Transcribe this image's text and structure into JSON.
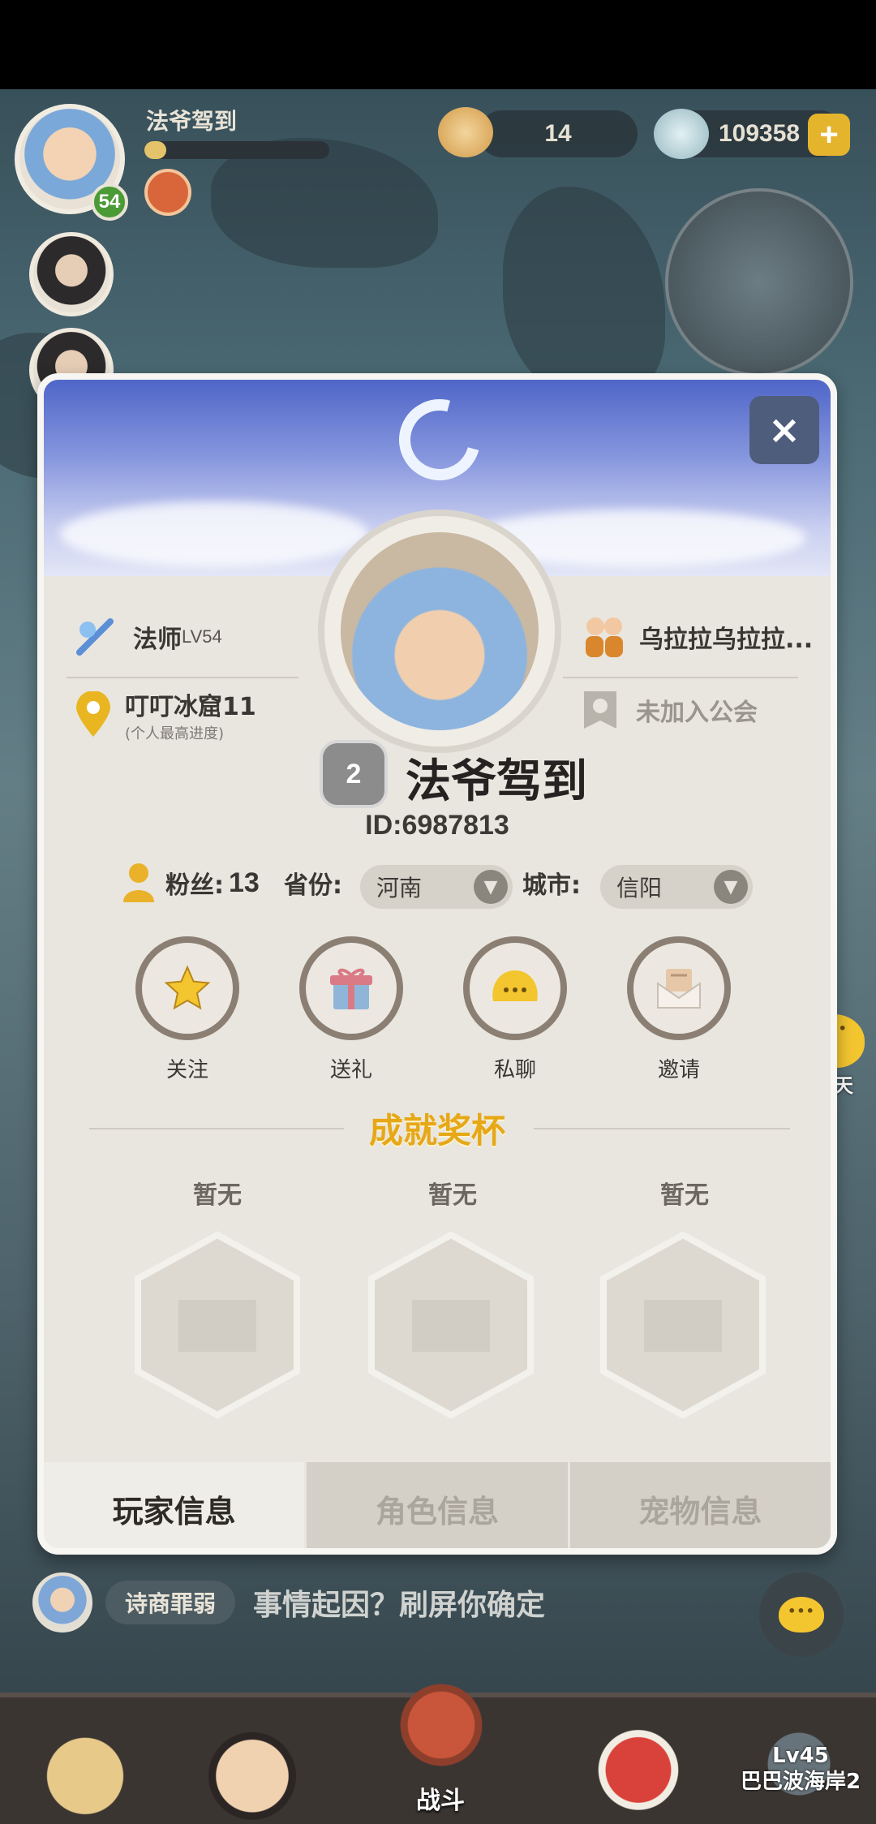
{
  "hud": {
    "player_name": "法爷驾到",
    "level": "54",
    "exp_fraction": 0.12,
    "shells": "14",
    "pearls": "109358",
    "plus": "+"
  },
  "profile": {
    "class_label": "法师",
    "class_level": "LV54",
    "progress_stage": "叮叮冰窟11",
    "progress_note": "(个人最高进度)",
    "partner": "乌拉拉乌拉拉...",
    "guild": "未加入公会",
    "rank": "2",
    "name": "法爷驾到",
    "id": "ID:6987813",
    "fans_label": "粉丝:",
    "fans_count": "13",
    "province_label": "省份:",
    "province_value": "河南",
    "city_label": "城市:",
    "city_value": "信阳",
    "close": "×"
  },
  "actions": [
    {
      "label": "关注",
      "icon": "star-icon"
    },
    {
      "label": "送礼",
      "icon": "gift-icon"
    },
    {
      "label": "私聊",
      "icon": "chat-bubble-icon"
    },
    {
      "label": "邀请",
      "icon": "envelope-icon"
    }
  ],
  "trophies": {
    "title": "成就奖杯",
    "slots": [
      "暂无",
      "暂无",
      "暂无"
    ]
  },
  "tabs": [
    "玩家信息",
    "角色信息",
    "宠物信息"
  ],
  "chat": {
    "float_label": "聊天",
    "speaker_tag": "诗商罪弱",
    "message": "事情起因？刷屏你确定"
  },
  "bottom_bar": {
    "battle_label": "战斗",
    "locked_level": "Lv45",
    "locked_name": "巴巴波海岸2"
  },
  "colors": {
    "accent_gold": "#e6a817",
    "panel_bg": "#e9e6df",
    "level_green": "#4a9a36"
  }
}
